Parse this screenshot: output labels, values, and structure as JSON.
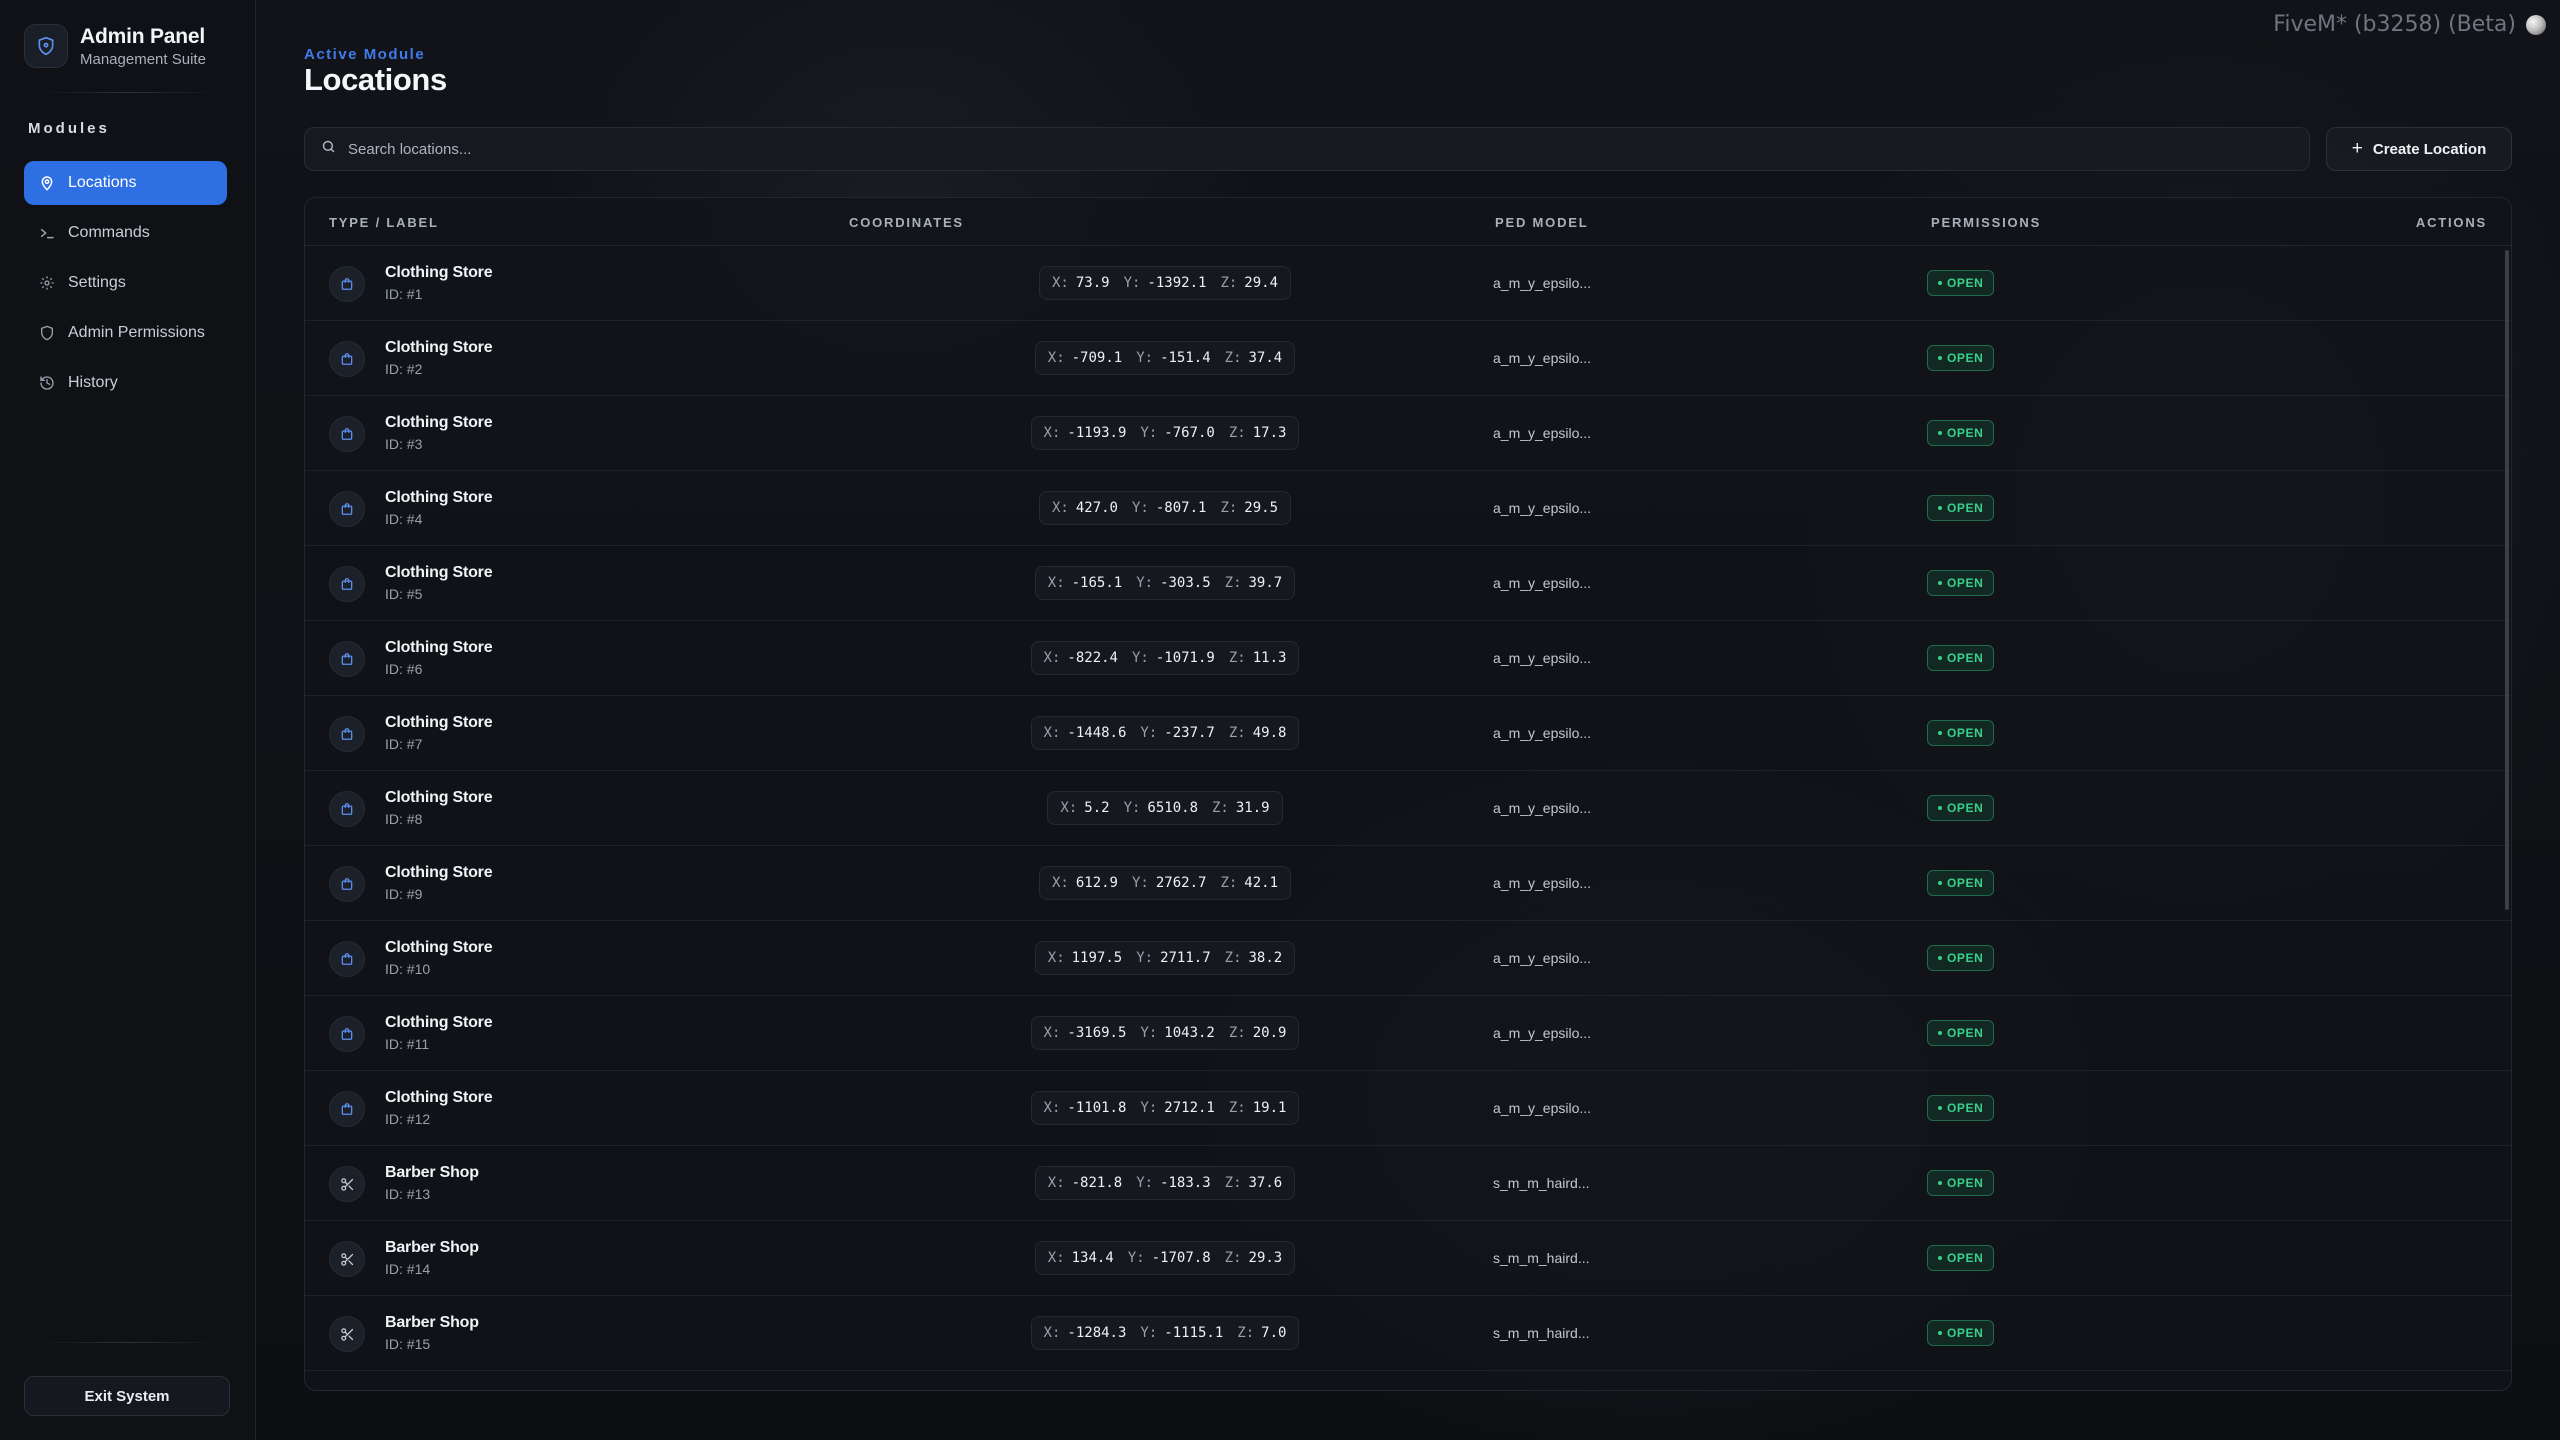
{
  "sidebar": {
    "brand_title": "Admin Panel",
    "brand_subtitle": "Management Suite",
    "modules_label": "Modules",
    "items": [
      {
        "label": "Locations",
        "icon": "map-pin-icon",
        "active": true
      },
      {
        "label": "Commands",
        "icon": "terminal-icon",
        "active": false
      },
      {
        "label": "Settings",
        "icon": "gear-icon",
        "active": false
      },
      {
        "label": "Admin Permissions",
        "icon": "shield-icon",
        "active": false
      },
      {
        "label": "History",
        "icon": "history-icon",
        "active": false
      }
    ],
    "exit_label": "Exit System"
  },
  "top_tag": "FiveM* (b3258) (Beta)",
  "header": {
    "active_module_label": "Active Module",
    "title": "Locations"
  },
  "search": {
    "placeholder": "Search locations..."
  },
  "create_button": "Create Location",
  "table": {
    "columns": [
      "TYPE / LABEL",
      "COORDINATES",
      "PED MODEL",
      "PERMISSIONS",
      "ACTIONS"
    ],
    "rows": [
      {
        "type": "clothing",
        "label": "Clothing Store",
        "id": "ID: #1",
        "x": "73.9",
        "y": "-1392.1",
        "z": "29.4",
        "ped": "a_m_y_epsilo...",
        "perm": "OPEN"
      },
      {
        "type": "clothing",
        "label": "Clothing Store",
        "id": "ID: #2",
        "x": "-709.1",
        "y": "-151.4",
        "z": "37.4",
        "ped": "a_m_y_epsilo...",
        "perm": "OPEN"
      },
      {
        "type": "clothing",
        "label": "Clothing Store",
        "id": "ID: #3",
        "x": "-1193.9",
        "y": "-767.0",
        "z": "17.3",
        "ped": "a_m_y_epsilo...",
        "perm": "OPEN"
      },
      {
        "type": "clothing",
        "label": "Clothing Store",
        "id": "ID: #4",
        "x": "427.0",
        "y": "-807.1",
        "z": "29.5",
        "ped": "a_m_y_epsilo...",
        "perm": "OPEN"
      },
      {
        "type": "clothing",
        "label": "Clothing Store",
        "id": "ID: #5",
        "x": "-165.1",
        "y": "-303.5",
        "z": "39.7",
        "ped": "a_m_y_epsilo...",
        "perm": "OPEN"
      },
      {
        "type": "clothing",
        "label": "Clothing Store",
        "id": "ID: #6",
        "x": "-822.4",
        "y": "-1071.9",
        "z": "11.3",
        "ped": "a_m_y_epsilo...",
        "perm": "OPEN"
      },
      {
        "type": "clothing",
        "label": "Clothing Store",
        "id": "ID: #7",
        "x": "-1448.6",
        "y": "-237.7",
        "z": "49.8",
        "ped": "a_m_y_epsilo...",
        "perm": "OPEN"
      },
      {
        "type": "clothing",
        "label": "Clothing Store",
        "id": "ID: #8",
        "x": "5.2",
        "y": "6510.8",
        "z": "31.9",
        "ped": "a_m_y_epsilo...",
        "perm": "OPEN"
      },
      {
        "type": "clothing",
        "label": "Clothing Store",
        "id": "ID: #9",
        "x": "612.9",
        "y": "2762.7",
        "z": "42.1",
        "ped": "a_m_y_epsilo...",
        "perm": "OPEN"
      },
      {
        "type": "clothing",
        "label": "Clothing Store",
        "id": "ID: #10",
        "x": "1197.5",
        "y": "2711.7",
        "z": "38.2",
        "ped": "a_m_y_epsilo...",
        "perm": "OPEN"
      },
      {
        "type": "clothing",
        "label": "Clothing Store",
        "id": "ID: #11",
        "x": "-3169.5",
        "y": "1043.2",
        "z": "20.9",
        "ped": "a_m_y_epsilo...",
        "perm": "OPEN"
      },
      {
        "type": "clothing",
        "label": "Clothing Store",
        "id": "ID: #12",
        "x": "-1101.8",
        "y": "2712.1",
        "z": "19.1",
        "ped": "a_m_y_epsilo...",
        "perm": "OPEN"
      },
      {
        "type": "barber",
        "label": "Barber Shop",
        "id": "ID: #13",
        "x": "-821.8",
        "y": "-183.3",
        "z": "37.6",
        "ped": "s_m_m_haird...",
        "perm": "OPEN"
      },
      {
        "type": "barber",
        "label": "Barber Shop",
        "id": "ID: #14",
        "x": "134.4",
        "y": "-1707.8",
        "z": "29.3",
        "ped": "s_m_m_haird...",
        "perm": "OPEN"
      },
      {
        "type": "barber",
        "label": "Barber Shop",
        "id": "ID: #15",
        "x": "-1284.3",
        "y": "-1115.1",
        "z": "7.0",
        "ped": "s_m_m_haird...",
        "perm": "OPEN"
      }
    ]
  },
  "colors": {
    "accent": "#2f6fe4",
    "open": "#38d08a",
    "background": "#0e1014"
  }
}
